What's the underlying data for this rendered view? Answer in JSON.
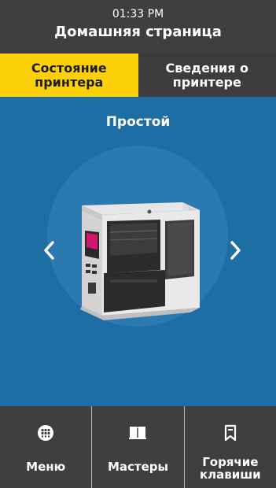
{
  "header": {
    "time": "01:33 PM",
    "title": "Домашняя страница"
  },
  "tabs": [
    {
      "label": "Состояние принтера",
      "active": true
    },
    {
      "label": "Сведения о принтере",
      "active": false
    }
  ],
  "main": {
    "status": "Простой",
    "prev_icon": "chevron-left-icon",
    "next_icon": "chevron-right-icon",
    "image": "printer-illustration"
  },
  "nav": [
    {
      "label": "Меню",
      "icon": "menu-grid-icon"
    },
    {
      "label": "Мастеры",
      "icon": "book-icon"
    },
    {
      "label": "Горячие клавиши",
      "icon": "bookmark-icon"
    }
  ],
  "colors": {
    "header_bg": "#3f3f3f",
    "active_tab": "#fcd10a",
    "main_bg": "#1e6ea6",
    "halo": "#2a7ab1"
  }
}
